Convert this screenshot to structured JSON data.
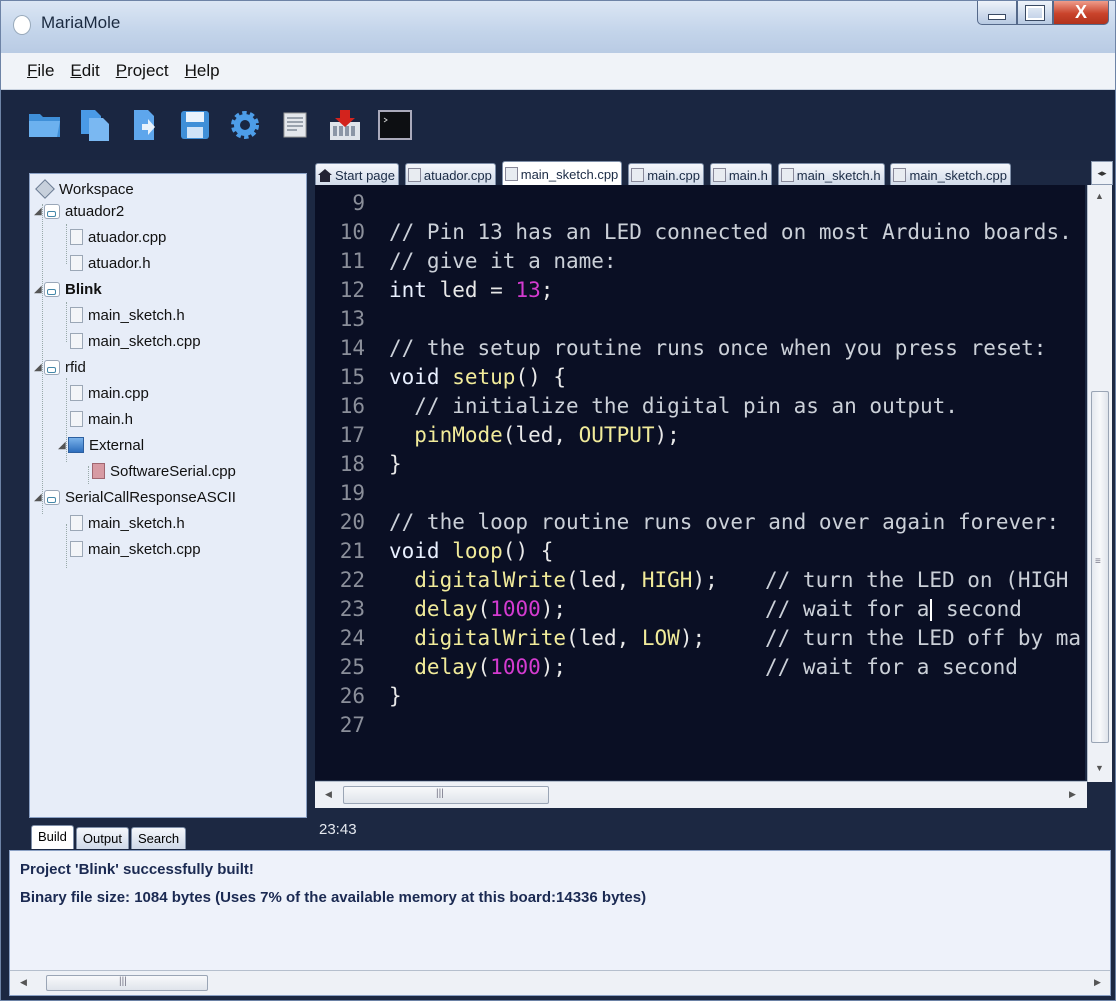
{
  "window": {
    "title": "MariaMole",
    "close_label": "X"
  },
  "menu": [
    {
      "underline": "F",
      "rest": "ile"
    },
    {
      "underline": "E",
      "rest": "dit"
    },
    {
      "underline": "P",
      "rest": "roject"
    },
    {
      "underline": "H",
      "rest": "elp"
    }
  ],
  "toolbar": [
    "open-folder-icon",
    "new-file-icon",
    "import-file-icon",
    "save-icon",
    "settings-gear-icon",
    "board-chip-icon",
    "upload-to-board-icon",
    "serial-monitor-icon"
  ],
  "tree": {
    "workspace": "Workspace",
    "items": [
      "atuador2",
      "atuador.cpp",
      "atuador.h",
      "Blink",
      "main_sketch.h",
      "main_sketch.cpp",
      "rfid",
      "main.cpp",
      "main.h",
      "External",
      "SoftwareSerial.cpp",
      "SerialCallResponseASCII",
      "main_sketch.h",
      "main_sketch.cpp"
    ]
  },
  "tabs": [
    "Start page",
    "atuador.cpp",
    "main_sketch.cpp",
    "main.cpp",
    "main.h",
    "main_sketch.h",
    "main_sketch.cpp"
  ],
  "active_tab": "main_sketch.cpp",
  "editor": {
    "line_numbers": [
      "9",
      "10",
      "11",
      "12",
      "13",
      "14",
      "15",
      "16",
      "17",
      "18",
      "19",
      "20",
      "21",
      "22",
      "23",
      "24",
      "25",
      "26",
      "27"
    ],
    "l10": "// Pin 13 has an LED connected on most Arduino boards.",
    "l11": "// give it a name:",
    "l12_kw": "int",
    "l12_var": " led = ",
    "l12_num": "13",
    "l12_end": ";",
    "l14": "// the setup routine runs once when you press reset:",
    "l15_kw": "void",
    "l15_fn": " setup",
    "l15_end": "() {",
    "l16": "  // initialize the digital pin as an output.",
    "l17_fn": "  pinMode",
    "l17_a": "(led, ",
    "l17_const": "OUTPUT",
    "l17_end": ");",
    "l18": "}",
    "l20": "// the loop routine runs over and over again forever:",
    "l21_kw": "void",
    "l21_fn": " loop",
    "l21_end": "() {",
    "l22_fn": "  digitalWrite",
    "l22_a": "(led, ",
    "l22_const": "HIGH",
    "l22_end": ");",
    "l22_c": "// turn the LED on (HIGH",
    "l23_fn": "  delay",
    "l23_a": "(",
    "l23_num": "1000",
    "l23_end": ");",
    "l23_c1": "// wait for a",
    "l23_c2": " second",
    "l24_fn": "  digitalWrite",
    "l24_a": "(led, ",
    "l24_const": "LOW",
    "l24_end": ");",
    "l24_c": "// turn the LED off by ma",
    "l25_fn": "  delay",
    "l25_a": "(",
    "l25_num": "1000",
    "l25_end": ");",
    "l25_c": "// wait for a second",
    "l26": "}"
  },
  "bottom_tabs": [
    "Build",
    "Output",
    "Search"
  ],
  "cursor_position": "23:43",
  "output": {
    "line1": "Project 'Blink' successfully built!",
    "line2": "Binary file size: 1084 bytes (Uses 7% of the available memory at this board:14336 bytes)"
  },
  "colors": {
    "editor_bg": "#0a0f24",
    "number": "#d43bd0",
    "function": "#f1eb9a",
    "output_text": "#1b2a52"
  }
}
